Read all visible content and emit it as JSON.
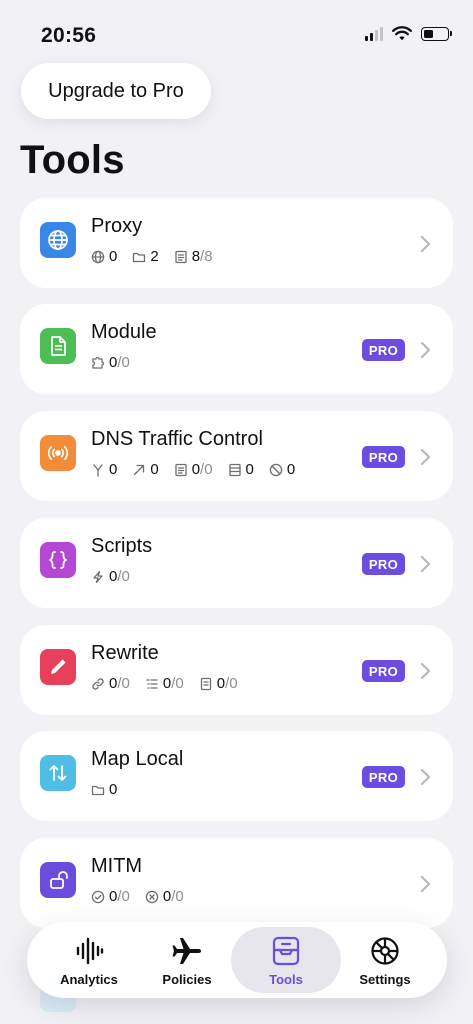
{
  "status_bar": {
    "time": "20:56"
  },
  "header": {
    "upgrade_label": "Upgrade to Pro",
    "title": "Tools"
  },
  "colors": {
    "accent": "#6c4de0",
    "proxy": "#3a86e6",
    "module": "#4cbe55",
    "dns": "#f28c38",
    "scripts": "#b548d3",
    "rewrite": "#e8405a",
    "map_local": "#4fbde4",
    "mitm": "#6b4dde"
  },
  "pro_badge": "PRO",
  "tools": [
    {
      "name": "Proxy",
      "icon": "globe-icon",
      "pro": false,
      "stats": [
        {
          "icon": "globe-small-icon",
          "value": "0",
          "denom": ""
        },
        {
          "icon": "folder-icon",
          "value": "2",
          "denom": ""
        },
        {
          "icon": "list-icon",
          "value": "8",
          "denom": "/8"
        }
      ]
    },
    {
      "name": "Module",
      "icon": "document-icon",
      "pro": true,
      "stats": [
        {
          "icon": "puzzle-icon",
          "value": "0",
          "denom": "/0"
        }
      ]
    },
    {
      "name": "DNS Traffic Control",
      "icon": "broadcast-icon",
      "pro": true,
      "stats": [
        {
          "icon": "fork-icon",
          "value": "0",
          "denom": ""
        },
        {
          "icon": "arrow-up-right-icon",
          "value": "0",
          "denom": ""
        },
        {
          "icon": "list-icon",
          "value": "0",
          "denom": "/0"
        },
        {
          "icon": "server-icon",
          "value": "0",
          "denom": ""
        },
        {
          "icon": "block-icon",
          "value": "0",
          "denom": ""
        }
      ]
    },
    {
      "name": "Scripts",
      "icon": "braces-icon",
      "pro": true,
      "stats": [
        {
          "icon": "bolt-icon",
          "value": "0",
          "denom": "/0"
        }
      ]
    },
    {
      "name": "Rewrite",
      "icon": "pencil-icon",
      "pro": true,
      "stats": [
        {
          "icon": "link-icon",
          "value": "0",
          "denom": "/0"
        },
        {
          "icon": "list-indent-icon",
          "value": "0",
          "denom": "/0"
        },
        {
          "icon": "note-icon",
          "value": "0",
          "denom": "/0"
        }
      ]
    },
    {
      "name": "Map Local",
      "icon": "swap-arrows-icon",
      "pro": true,
      "stats": [
        {
          "icon": "folder-icon",
          "value": "0",
          "denom": ""
        }
      ]
    },
    {
      "name": "MITM",
      "icon": "unlock-icon",
      "pro": false,
      "stats": [
        {
          "icon": "check-circle-icon",
          "value": "0",
          "denom": "/0"
        },
        {
          "icon": "x-circle-icon",
          "value": "0",
          "denom": "/0"
        }
      ]
    }
  ],
  "tab_bar": {
    "active": "Tools",
    "tabs": [
      {
        "label": "Analytics",
        "icon": "waveform-icon"
      },
      {
        "label": "Policies",
        "icon": "airplane-icon"
      },
      {
        "label": "Tools",
        "icon": "tray-icon"
      },
      {
        "label": "Settings",
        "icon": "gear-icon"
      }
    ]
  }
}
